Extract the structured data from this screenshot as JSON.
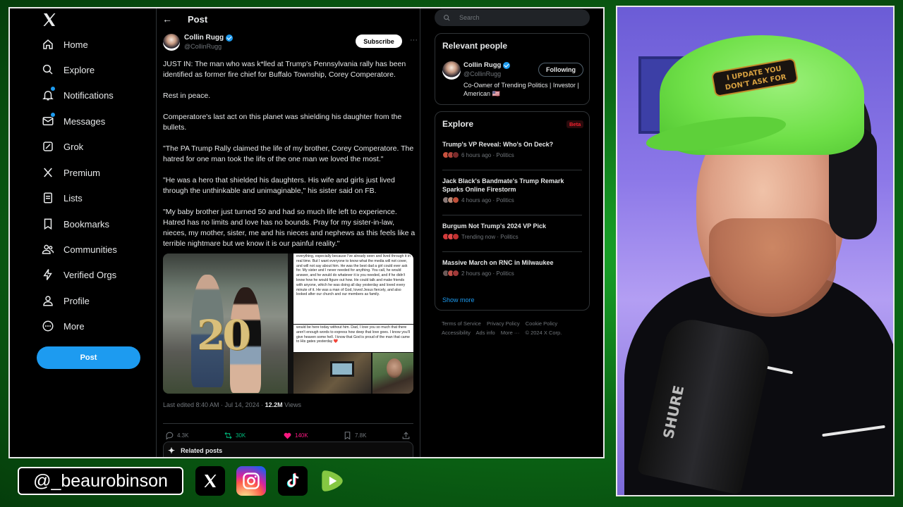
{
  "nav": {
    "items": [
      {
        "label": "Home",
        "icon": "home-icon"
      },
      {
        "label": "Explore",
        "icon": "search-icon"
      },
      {
        "label": "Notifications",
        "icon": "bell-icon"
      },
      {
        "label": "Messages",
        "icon": "mail-icon"
      },
      {
        "label": "Grok",
        "icon": "grok-icon"
      },
      {
        "label": "Premium",
        "icon": "x-icon"
      },
      {
        "label": "Lists",
        "icon": "list-icon"
      },
      {
        "label": "Bookmarks",
        "icon": "bookmark-icon"
      },
      {
        "label": "Communities",
        "icon": "people-icon"
      },
      {
        "label": "Verified Orgs",
        "icon": "lightning-icon"
      },
      {
        "label": "Profile",
        "icon": "user-icon"
      },
      {
        "label": "More",
        "icon": "more-circle-icon"
      }
    ],
    "post_button": "Post"
  },
  "header": {
    "back": "←",
    "title": "Post"
  },
  "post": {
    "author_name": "Collin Rugg",
    "author_handle": "@CollinRugg",
    "subscribe": "Subscribe",
    "more": "···",
    "paragraphs": [
      "JUST IN: The man who was k*lled at Trump's Pennsylvania rally has been identified as former fire chief for Buffalo Township, Corey Comperatore.",
      "Rest in peace.",
      "Comperatore's last act on this planet was shielding his daughter from the bullets.",
      "\"The PA Trump Rally claimed the life of my brother, Corey Comperatore. The hatred for one man took the life of the one man we loved the most.\"",
      "\"He was a hero that shielded his daughters. His wife and girls just lived through the unthinkable and unimaginable,\" his sister said on FB.",
      "\"My baby brother just turned 50 and had so much life left to experience. Hatred has no limits and love has no bounds. Pray for my sister-in-law, nieces, my mother, sister, me and his nieces and nephews as this feels like a terrible nightmare but we know it is our painful reality.\""
    ],
    "media": {
      "balloon_text": "20",
      "doc1_text": "everything, especially because I've already seen and lived through it in real time. But I want everyone to know what the media will not cover, and will not say about him. He was the best dad a girl could ever ask for. My sister and I never needed for anything. You call, he would answer, and he would do whatever it is you needed, and if he didn't know how he would figure out how. He could talk and make friends with anyone, which he was doing all day yesterday and loved every minute of it. He was a man of God, loved Jesus fiercely, and also looked after our church and our members as family.",
      "doc2_text": "would be here today without him. Dad, I love you so much that there aren't enough words to express how deep that love goes. I know you'll give heaven some hell. I know that God is proud of the man that came to His gates yesterday ❤️"
    },
    "meta_prefix": "Last edited 8:40 AM · Jul 14, 2024 · ",
    "views_count": "12.2M",
    "views_label": " Views",
    "stats": {
      "replies": "4.3K",
      "reposts": "30K",
      "likes": "140K",
      "bookmarks": "7.8K"
    },
    "related": "Related posts"
  },
  "search": {
    "placeholder": "Search"
  },
  "relevant": {
    "title": "Relevant people",
    "name": "Collin Rugg",
    "handle": "@CollinRugg",
    "bio": "Co-Owner of Trending Politics | Investor | American 🇺🇸",
    "follow_label": "Following"
  },
  "explore": {
    "title": "Explore",
    "badge": "Beta",
    "trends": [
      {
        "title": "Trump's VP Reveal: Who's On Deck?",
        "time": "6 hours ago",
        "category": "Politics"
      },
      {
        "title": "Jack Black's Bandmate's Trump Remark Sparks Online Firestorm",
        "time": "4 hours ago",
        "category": "Politics"
      },
      {
        "title": "Burgum Not Trump's 2024 VP Pick",
        "time": "Trending now",
        "category": "Politics"
      },
      {
        "title": "Massive March on RNC in Milwaukee",
        "time": "2 hours ago",
        "category": "Politics"
      }
    ],
    "show_more": "Show more"
  },
  "footer": {
    "line1": [
      "Terms of Service",
      "Privacy Policy",
      "Cookie Policy"
    ],
    "line2": [
      "Accessibility",
      "Ads info",
      "More ···",
      "© 2024 X Corp."
    ]
  },
  "overlay": {
    "handle": "@_beaurobinson",
    "cap_patch": "I UPDATE YOU\nDON'T ASK FOR",
    "mic_brand": "SHURE"
  },
  "colors": {
    "accent": "#1d9bf0",
    "like": "#f91880",
    "repost": "#00ba7c",
    "greenscreen": "#0c6a16"
  }
}
